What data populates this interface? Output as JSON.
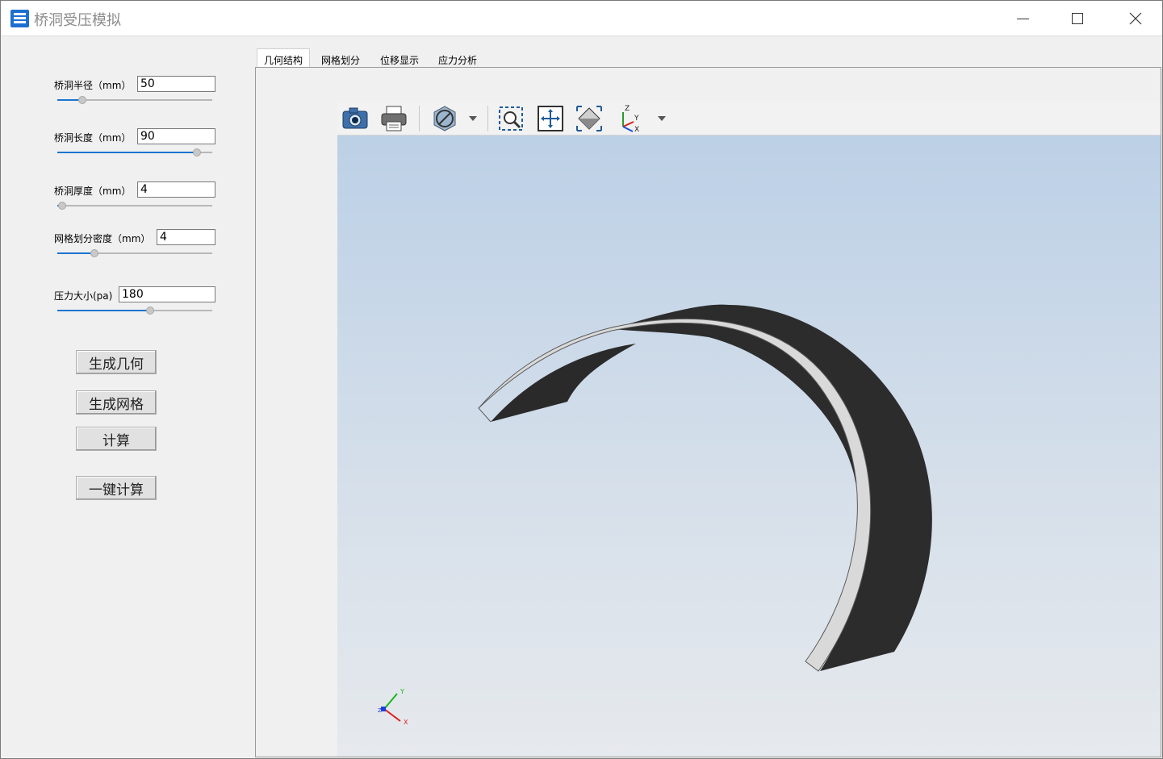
{
  "window": {
    "title": "桥洞受压模拟",
    "minimize_label": "—",
    "maximize_label": "☐",
    "close_label": "✕"
  },
  "params": [
    {
      "label": "桥洞半径（mm）",
      "value": "50",
      "slider_fraction": 0.16
    },
    {
      "label": "桥洞长度（mm）",
      "value": "90",
      "slider_fraction": 0.9
    },
    {
      "label": "桥洞厚度（mm）",
      "value": "4",
      "slider_fraction": 0.03
    },
    {
      "label": "网格划分密度（mm）",
      "value": "4",
      "slider_fraction": 0.24
    },
    {
      "label": "压力大小(pa)",
      "value": "180",
      "slider_fraction": 0.6
    }
  ],
  "buttons": {
    "generate_geometry": "生成几何",
    "generate_mesh": "生成网格",
    "compute": "计算",
    "one_click_compute": "一键计算"
  },
  "tabs": [
    {
      "label": "几何结构",
      "active": true
    },
    {
      "label": "网格划分",
      "active": false
    },
    {
      "label": "位移显示",
      "active": false
    },
    {
      "label": "应力分析",
      "active": false
    }
  ],
  "toolbar": {
    "icons": [
      "camera-icon",
      "print-icon",
      "no-display-icon",
      "dropdown-arrow-icon",
      "zoom-window-icon",
      "fit-all-icon",
      "view-cube-icon",
      "axes-view-icon",
      "dropdown-arrow-icon"
    ],
    "axes_labels": {
      "z": "Z",
      "y": "Y",
      "x": "X"
    }
  },
  "triad": {
    "x": "X",
    "y": "Y",
    "z": "Z"
  },
  "colors": {
    "accent": "#1e74d0",
    "background_top": "#bcd0e6",
    "background_bottom": "#e6e9ed",
    "model_dark": "#2c2c2c",
    "model_light": "#d8d8d8"
  }
}
